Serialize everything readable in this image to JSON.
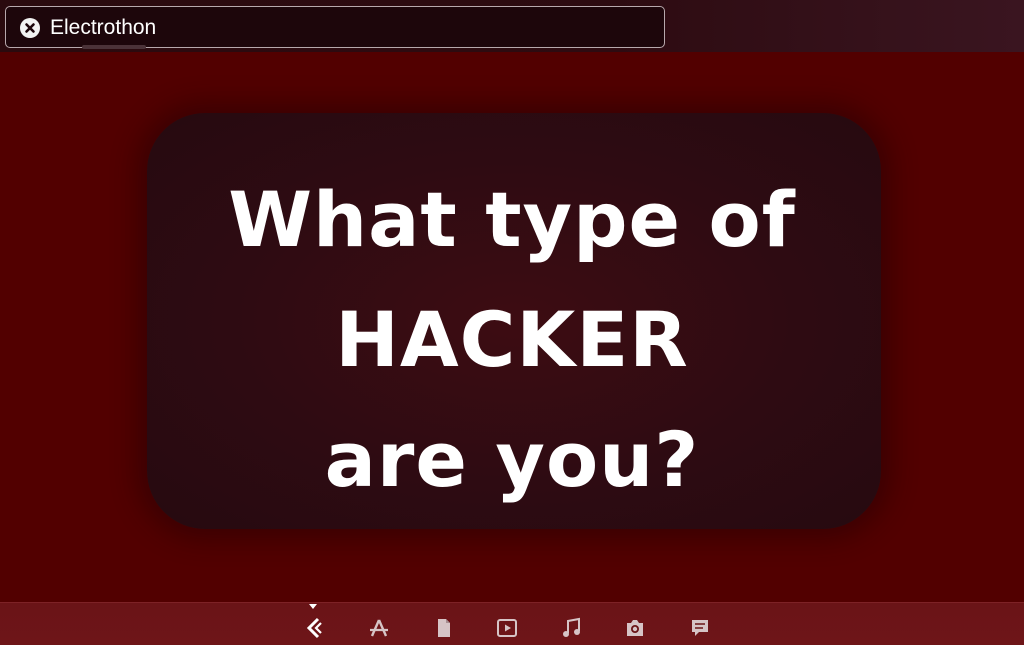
{
  "search": {
    "value": "Electrothon"
  },
  "card": {
    "lines": [
      "What type of",
      "HACKER",
      "are you?"
    ]
  },
  "dock": {
    "items": [
      {
        "icon": "app-drawer-icon",
        "active": true
      },
      {
        "icon": "app-store-icon"
      },
      {
        "icon": "document-icon"
      },
      {
        "icon": "video-player-icon"
      },
      {
        "icon": "music-note-icon"
      },
      {
        "icon": "camera-icon"
      },
      {
        "icon": "chat-icon"
      }
    ]
  },
  "colors": {
    "background": "#520000",
    "card": "#2e0b12",
    "dock": "#6a1417",
    "text": "#ffffff"
  }
}
